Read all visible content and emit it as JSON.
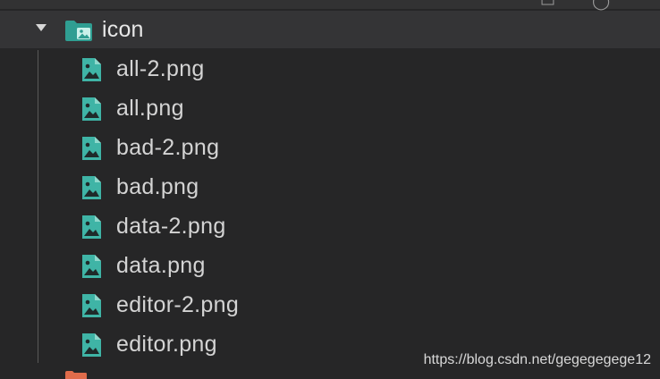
{
  "explorer": {
    "folder": {
      "name": "icon",
      "expanded": true,
      "icon": "folder-image-icon",
      "icon_color": "#3fb4a6"
    },
    "files": [
      {
        "name": "all-2.png",
        "icon": "image-file-icon"
      },
      {
        "name": "all.png",
        "icon": "image-file-icon"
      },
      {
        "name": "bad-2.png",
        "icon": "image-file-icon"
      },
      {
        "name": "bad.png",
        "icon": "image-file-icon"
      },
      {
        "name": "data-2.png",
        "icon": "image-file-icon"
      },
      {
        "name": "data.png",
        "icon": "image-file-icon"
      },
      {
        "name": "editor-2.png",
        "icon": "image-file-icon"
      },
      {
        "name": "editor.png",
        "icon": "image-file-icon"
      }
    ],
    "file_icon_color": "#3fb4a6",
    "next_folder_icon_color": "#e06c4b"
  },
  "watermark": {
    "text": "https://blog.csdn.net/gegegegege12"
  },
  "colors": {
    "background": "#262627",
    "selected_row": "#343436",
    "text": "#d4d4d4"
  }
}
